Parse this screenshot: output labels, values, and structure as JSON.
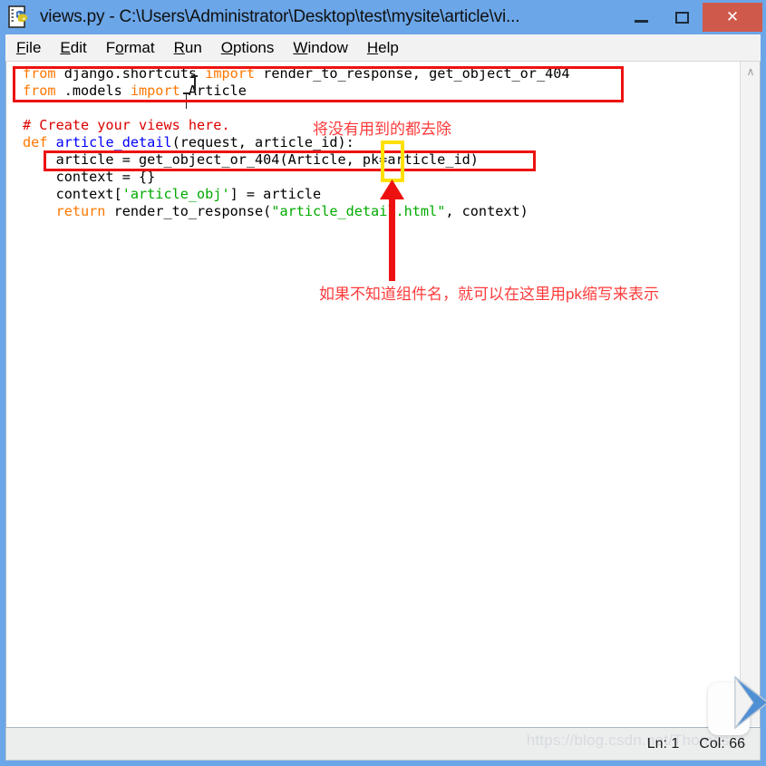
{
  "window": {
    "title": "views.py - C:\\Users\\Administrator\\Desktop\\test\\mysite\\article\\vi...",
    "app_icon": "python-idle-icon",
    "frame_color": "#6ba6e8",
    "close_button_color": "#cf5a4b",
    "buttons": {
      "minimize": "–",
      "maximize": "□",
      "close": "✕"
    }
  },
  "menubar": {
    "items": [
      {
        "label": "File",
        "accel_prefix": "",
        "accel": "F",
        "accel_suffix": "ile"
      },
      {
        "label": "Edit",
        "accel_prefix": "",
        "accel": "E",
        "accel_suffix": "dit"
      },
      {
        "label": "Format",
        "accel_prefix": "F",
        "accel": "o",
        "accel_suffix": "rmat"
      },
      {
        "label": "Run",
        "accel_prefix": "",
        "accel": "R",
        "accel_suffix": "un"
      },
      {
        "label": "Options",
        "accel_prefix": "",
        "accel": "O",
        "accel_suffix": "ptions"
      },
      {
        "label": "Window",
        "accel_prefix": "",
        "accel": "W",
        "accel_suffix": "indow"
      },
      {
        "label": "Help",
        "accel_prefix": "",
        "accel": "H",
        "accel_suffix": "elp"
      }
    ]
  },
  "editor": {
    "language": "python",
    "syntax_colors": {
      "keyword": "#ff7700",
      "comment": "#dd0000",
      "string": "#00aa00",
      "definition": "#0000ff",
      "default": "#000000"
    },
    "lines": [
      "from django.shortcuts import render_to_response, get_object_or_404",
      "from .models import Article",
      "",
      "# Create your views here.",
      "def article_detail(request, article_id):",
      "    article = get_object_or_404(Article, pk=article_id)",
      "    context = {}",
      "    context['article_obj'] = article",
      "    return render_to_response(\"article_detail.html\", context)"
    ],
    "scrollbar": {
      "up_arrow": "∧"
    }
  },
  "statusbar": {
    "line_label": "Ln: 1",
    "col_label": "Col: 66"
  },
  "watermark": {
    "text": "https://blog.csdn.net/Thomas_1"
  },
  "annotations": {
    "red_box_imports": {
      "label": "highlight around import statements",
      "color": "#ee1111"
    },
    "red_box_getobject": {
      "label": "highlight around get_object_or_404 call",
      "color": "#ee1111"
    },
    "yellow_box_pk": {
      "label": "highlight around pk keyword argument",
      "color": "#ffe000"
    },
    "note_top": "将没有用到的都去除",
    "note_bottom": "如果不知道组件名，就可以在这里用pk缩写来表示",
    "arrow_color": "#ee1111"
  }
}
